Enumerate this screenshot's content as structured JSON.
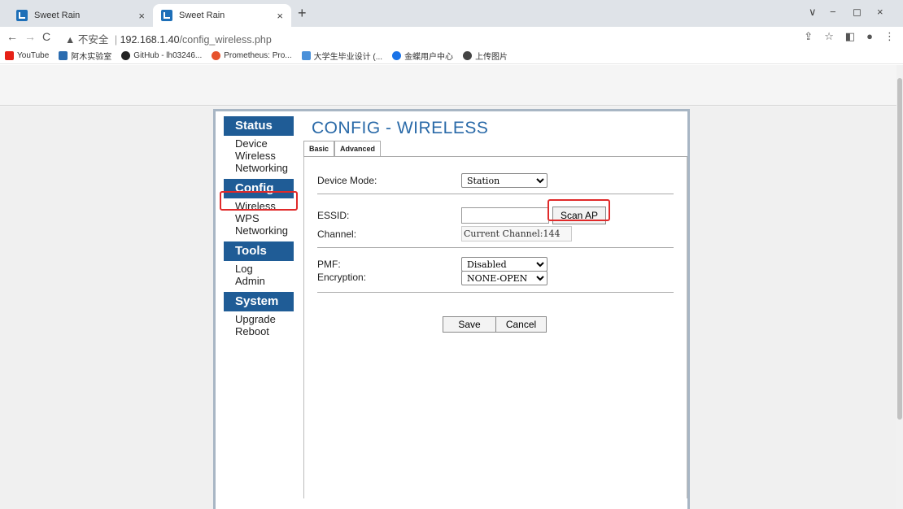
{
  "browser": {
    "tabs": [
      {
        "title": "Sweet Rain",
        "close": "×"
      },
      {
        "title": "Sweet Rain",
        "close": "×"
      }
    ],
    "new_tab": "+",
    "window_controls": [
      "∨",
      "−",
      "◻",
      "×"
    ],
    "nav": {
      "back": "←",
      "forward": "→",
      "reload": "C"
    },
    "security_label": "▲ 不安全",
    "url_host": "192.168.1.40",
    "url_path": "/config_wireless.php",
    "address_icons": [
      "share-icon",
      "star-icon",
      "sidebar-icon",
      "profile-icon",
      "menu-icon"
    ],
    "bookmarks": [
      {
        "label": "YouTube",
        "color": "#e62117"
      },
      {
        "label": "阿木实验室",
        "color": "#2b6cb0"
      },
      {
        "label": "GitHub - lh03246...",
        "color": "#222222"
      },
      {
        "label": "Prometheus: Pro...",
        "color": "#e6522c"
      },
      {
        "label": "大学生毕业设计 (...",
        "color": "#4a90d9"
      },
      {
        "label": "金蝶用户中心",
        "color": "#1a73e8"
      },
      {
        "label": "上传图片",
        "color": "#444444"
      }
    ]
  },
  "sidebar": {
    "sections": [
      {
        "title": "Status",
        "items": [
          "Device",
          "Wireless",
          "Networking"
        ]
      },
      {
        "title": "Config",
        "items": [
          "Wireless",
          "WPS",
          "Networking"
        ]
      },
      {
        "title": "Tools",
        "items": [
          "Log",
          "Admin"
        ]
      },
      {
        "title": "System",
        "items": [
          "Upgrade",
          "Reboot"
        ]
      }
    ]
  },
  "page": {
    "title": "CONFIG - WIRELESS",
    "tabs": [
      "Basic",
      "Advanced"
    ],
    "device_mode_label": "Device Mode:",
    "device_mode_value": "Station",
    "essid_label": "ESSID:",
    "essid_value": "",
    "scan_button": "Scan AP",
    "channel_label": "Channel:",
    "channel_value": "Current Channel:144",
    "pmf_label": "PMF:",
    "pmf_value": "Disabled",
    "encryption_label": "Encryption:",
    "encryption_value": "NONE-OPEN",
    "save_button": "Save",
    "cancel_button": "Cancel"
  },
  "colors": {
    "section_header": "#1f5c96",
    "title": "#2a6aa8",
    "highlight": "#e02a2a"
  }
}
